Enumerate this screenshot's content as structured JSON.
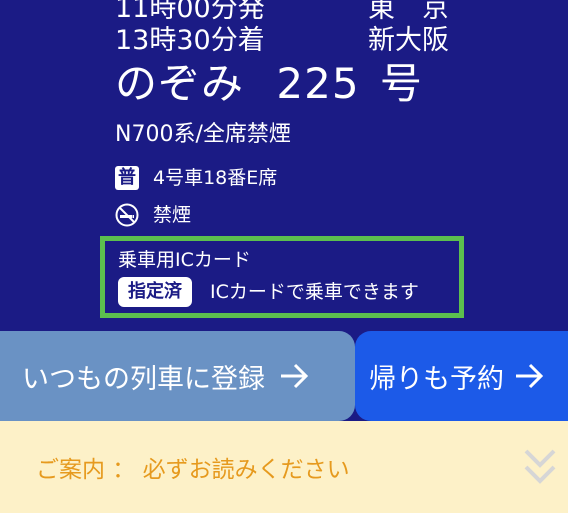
{
  "trip": {
    "depart_time": "11時00分発",
    "depart_station": "東　京",
    "arrive_time": "13時30分着",
    "arrive_station": "新大阪",
    "train_name": "のぞみ",
    "train_number": "225",
    "train_suffix": "号",
    "train_type": "N700系/全席禁煙"
  },
  "seat": {
    "class_icon_label": "普",
    "class_icon": "ordinary-class-icon",
    "seat_text": "4号車18番E席",
    "smoking_icon": "no-smoking-icon",
    "smoking_text": "禁煙"
  },
  "ic_card": {
    "title": "乗車用ICカード",
    "status": "指定済",
    "message": "ICカードで乗車できます"
  },
  "buttons": {
    "register_label": "いつもの列車に登録",
    "return_label": "帰りも予約"
  },
  "notice": {
    "label": "ご案内 ： 必ずお読みください"
  },
  "colors": {
    "background": "#1b1b85",
    "highlight_border": "#5cbf4e",
    "register_button": "#6a92c4",
    "return_button": "#1c5ae8",
    "notice_bg": "#fdf1c8",
    "notice_text": "#e69a1e"
  }
}
